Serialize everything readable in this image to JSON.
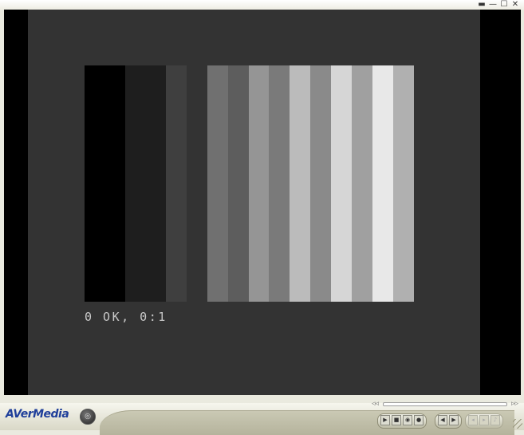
{
  "window": {
    "controls": {
      "compact_glyph": "▬",
      "minimize_glyph": "—",
      "maximize_glyph": "☐",
      "close_glyph": "✕"
    }
  },
  "video": {
    "status_text": "0 OK, 0:1",
    "test_bars": [
      {
        "shade": "#000000",
        "weight": 51
      },
      {
        "shade": "#1e1e1e",
        "weight": 51
      },
      {
        "shade": "#3f3f3f",
        "weight": 26
      },
      {
        "shade": "#333333",
        "weight": 26
      },
      {
        "shade": "#707070",
        "weight": 26
      },
      {
        "shade": "#5d5d5d",
        "weight": 26
      },
      {
        "shade": "#959595",
        "weight": 26
      },
      {
        "shade": "#7a7a7a",
        "weight": 26
      },
      {
        "shade": "#bbbbbb",
        "weight": 26
      },
      {
        "shade": "#8a8a8a",
        "weight": 26
      },
      {
        "shade": "#d6d6d6",
        "weight": 26
      },
      {
        "shade": "#a0a0a0",
        "weight": 26
      },
      {
        "shade": "#e8e8e8",
        "weight": 26
      },
      {
        "shade": "#b0b0b0",
        "weight": 26
      }
    ]
  },
  "seek": {
    "left_glyph": "◃◃",
    "right_glyph": "▹▹"
  },
  "brand": {
    "logo_text": "AVerMedia",
    "color": "#1f3f9a"
  },
  "menu_button": {
    "glyph": "◎"
  },
  "controls": {
    "play": "▶",
    "stop": "■",
    "record": "◉",
    "rec_mark": "●",
    "prev": "◀",
    "next": "▶",
    "ch_prev": "◂",
    "ch_next": "▸",
    "audio": "♪"
  }
}
